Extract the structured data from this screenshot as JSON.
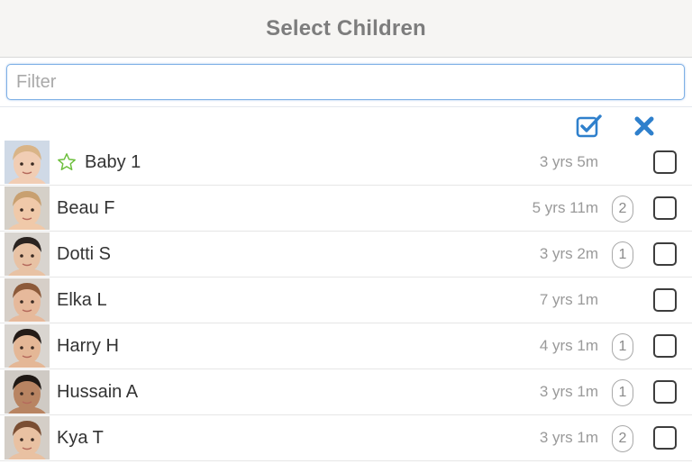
{
  "header": {
    "title": "Select Children"
  },
  "filter": {
    "placeholder": "Filter",
    "value": ""
  },
  "actions": {
    "select_all_icon": "checkbox-checked-icon",
    "clear_icon": "close-x-icon",
    "accent_color": "#2f80cc"
  },
  "children": [
    {
      "name": "Baby 1",
      "age": "3 yrs 5m",
      "badge": "",
      "favorite": true,
      "checked": false,
      "skin": "#f1cdb4",
      "hair": "#d9b487",
      "bg": "#cfd9e6"
    },
    {
      "name": "Beau F",
      "age": "5 yrs 11m",
      "badge": "2",
      "favorite": false,
      "checked": false,
      "skin": "#f0c9a9",
      "hair": "#c8a070",
      "bg": "#d5d0c8"
    },
    {
      "name": "Dotti S",
      "age": "3 yrs 2m",
      "badge": "1",
      "favorite": false,
      "checked": false,
      "skin": "#e8c2a4",
      "hair": "#2a2320",
      "bg": "#d8d4cf"
    },
    {
      "name": "Elka L",
      "age": "7 yrs 1m",
      "badge": "",
      "favorite": false,
      "checked": false,
      "skin": "#e6b99b",
      "hair": "#8c5a3a",
      "bg": "#d6cfc8"
    },
    {
      "name": "Harry H",
      "age": "4 yrs 1m",
      "badge": "1",
      "favorite": false,
      "checked": false,
      "skin": "#e4b796",
      "hair": "#231b17",
      "bg": "#d9d5d0"
    },
    {
      "name": "Hussain A",
      "age": "3 yrs 1m",
      "badge": "1",
      "favorite": false,
      "checked": false,
      "skin": "#b88462",
      "hair": "#1f1814",
      "bg": "#cfcac4"
    },
    {
      "name": "Kya T",
      "age": "3 yrs 1m",
      "badge": "2",
      "favorite": false,
      "checked": false,
      "skin": "#e9c1a2",
      "hair": "#7a4e33",
      "bg": "#d4cec7"
    }
  ]
}
